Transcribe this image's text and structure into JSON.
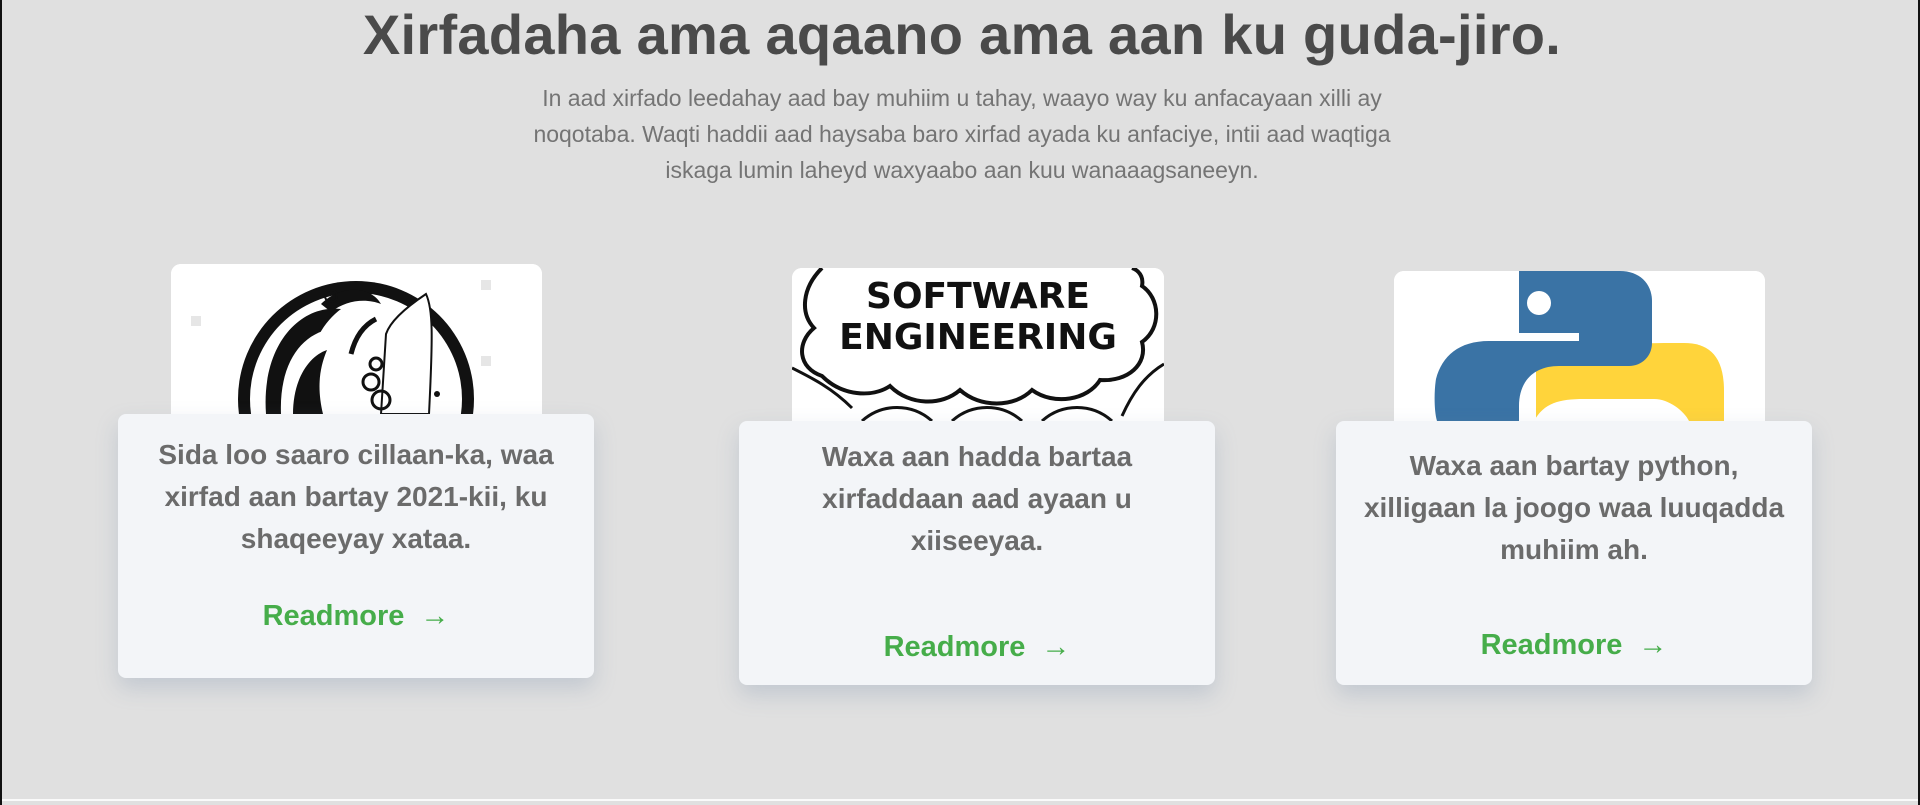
{
  "header": {
    "title": "Xirfadaha ama aqaano ama aan ku guda-jiro.",
    "subtitle": "In aad xirfado leedahay aad bay muhiim u tahay, waayo way ku anfacayaan xilli ay noqotaba. Waqti haddii aad haysaba baro xirfad ayada ku anfaciye, intii aad waqtiga iskaga lumin laheyd waxyaabo aan kuu wanaaagsaneeyn."
  },
  "cards": [
    {
      "text": "Sida loo saaro cillaan-ka, waa xirfad aan bartay 2021-kii, ku shaqeeyay xataa.",
      "link_label": "Readmore",
      "arrow": "→",
      "image": "henna-circle-icon"
    },
    {
      "text": "Waxa aan hadda bartaa xirfaddaan aad ayaan u xiiseeyaa.",
      "link_label": "Readmore",
      "arrow": "→",
      "image": "software-engineering-cloud",
      "image_caption_line1": "SOFTWARE",
      "image_caption_line2": "ENGINEERING"
    },
    {
      "text": "Waxa aan bartay python, xilligaan la joogo waa luuqadda muhiim ah.",
      "link_label": "Readmore",
      "arrow": "→",
      "image": "python-logo-icon"
    }
  ],
  "colors": {
    "background": "#e0e0e0",
    "card": "#f3f5f8",
    "link": "#46ad4a",
    "title": "#4a4a4a",
    "python_blue": "#3a73a5",
    "python_yellow": "#ffd43b"
  }
}
